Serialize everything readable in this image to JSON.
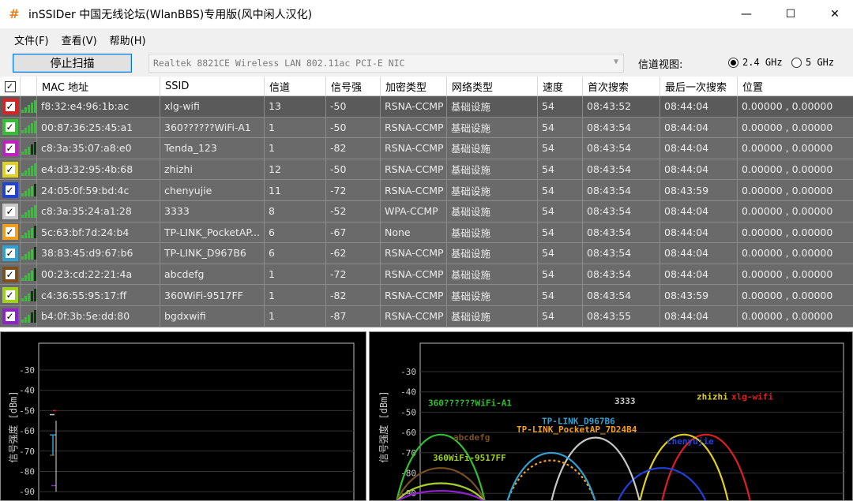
{
  "window": {
    "icon": "#",
    "title": "inSSIDer 中国无线论坛(WlanBBS)专用版(风中闲人汉化)",
    "controls": {
      "minimize": "—",
      "maximize": "☐",
      "close": "✕"
    }
  },
  "menu": [
    "文件(F)",
    "查看(V)",
    "帮助(H)"
  ],
  "toolbar": {
    "scan_button": "停止扫描",
    "nic": "Realtek 8821CE Wireless LAN 802.11ac PCI-E NIC",
    "channel_view_label": "信道视图:",
    "band_24": "2.4 GHz",
    "band_5": "5 GHz",
    "selected_band": "2.4 GHz"
  },
  "table": {
    "headers": [
      "MAC 地址",
      "SSID",
      "信道",
      "信号强",
      "加密类型",
      "网络类型",
      "速度",
      "首次搜索",
      "最后一次搜索",
      "位置"
    ],
    "rows": [
      {
        "color": "#e02020",
        "bars": 5,
        "mac": "f8:32:e4:96:1b:ac",
        "ssid": "xlg-wifi",
        "channel": "13",
        "rssi": "-50",
        "security": "RSNA-CCMP",
        "net_type": "基础设施",
        "speed": "54",
        "first": "08:43:52",
        "last": "08:44:04",
        "loc": "0.00000 , 0.00000"
      },
      {
        "color": "#30c030",
        "bars": 5,
        "mac": "00:87:36:25:45:a1",
        "ssid": "360??????WiFi-A1",
        "channel": "1",
        "rssi": "-50",
        "security": "RSNA-CCMP",
        "net_type": "基础设施",
        "speed": "54",
        "first": "08:43:54",
        "last": "08:44:04",
        "loc": "0.00000 , 0.00000"
      },
      {
        "color": "#c020c0",
        "bars": 3,
        "mac": "c8:3a:35:07:a8:e0",
        "ssid": "Tenda_123",
        "channel": "1",
        "rssi": "-82",
        "security": "RSNA-CCMP",
        "net_type": "基础设施",
        "speed": "54",
        "first": "08:43:54",
        "last": "08:44:04",
        "loc": "0.00000 , 0.00000"
      },
      {
        "color": "#e0d020",
        "bars": 5,
        "mac": "e4:d3:32:95:4b:68",
        "ssid": "zhizhi",
        "channel": "12",
        "rssi": "-50",
        "security": "RSNA-CCMP",
        "net_type": "基础设施",
        "speed": "54",
        "first": "08:43:54",
        "last": "08:44:04",
        "loc": "0.00000 , 0.00000"
      },
      {
        "color": "#2040e0",
        "bars": 4,
        "mac": "24:05:0f:59:bd:4c",
        "ssid": "chenyujie",
        "channel": "11",
        "rssi": "-72",
        "security": "RSNA-CCMP",
        "net_type": "基础设施",
        "speed": "54",
        "first": "08:43:54",
        "last": "08:43:59",
        "loc": "0.00000 , 0.00000"
      },
      {
        "color": "#c8c8c8",
        "bars": 5,
        "mac": "c8:3a:35:24:a1:28",
        "ssid": "3333",
        "channel": "8",
        "rssi": "-52",
        "security": "WPA-CCMP",
        "net_type": "基础设施",
        "speed": "54",
        "first": "08:43:54",
        "last": "08:44:04",
        "loc": "0.00000 , 0.00000"
      },
      {
        "color": "#f0a020",
        "bars": 4,
        "mac": "5c:63:bf:7d:24:b4",
        "ssid": "TP-LINK_PocketAP...",
        "channel": "6",
        "rssi": "-67",
        "security": "None",
        "net_type": "基础设施",
        "speed": "54",
        "first": "08:43:54",
        "last": "08:44:04",
        "loc": "0.00000 , 0.00000"
      },
      {
        "color": "#30a0d0",
        "bars": 4,
        "mac": "38:83:45:d9:67:b6",
        "ssid": "TP-LINK_D967B6",
        "channel": "6",
        "rssi": "-62",
        "security": "RSNA-CCMP",
        "net_type": "基础设施",
        "speed": "54",
        "first": "08:43:54",
        "last": "08:44:04",
        "loc": "0.00000 , 0.00000"
      },
      {
        "color": "#7a5020",
        "bars": 4,
        "mac": "00:23:cd:22:21:4a",
        "ssid": "abcdefg",
        "channel": "1",
        "rssi": "-72",
        "security": "RSNA-CCMP",
        "net_type": "基础设施",
        "speed": "54",
        "first": "08:43:54",
        "last": "08:44:04",
        "loc": "0.00000 , 0.00000"
      },
      {
        "color": "#a0d020",
        "bars": 3,
        "mac": "c4:36:55:95:17:ff",
        "ssid": "360WiFi-9517FF",
        "channel": "1",
        "rssi": "-82",
        "security": "RSNA-CCMP",
        "net_type": "基础设施",
        "speed": "54",
        "first": "08:43:54",
        "last": "08:43:59",
        "loc": "0.00000 , 0.00000"
      },
      {
        "color": "#9020d0",
        "bars": 3,
        "mac": "b4:0f:3b:5e:dd:80",
        "ssid": "bgdxwifi",
        "channel": "1",
        "rssi": "-87",
        "security": "RSNA-CCMP",
        "net_type": "基础设施",
        "speed": "54",
        "first": "08:43:55",
        "last": "08:44:04",
        "loc": "0.00000 , 0.00000"
      }
    ]
  },
  "graphs": {
    "ylabel": "信号强度 [dBm]",
    "yticks": [
      "-30",
      "-40",
      "-50",
      "-60",
      "-70",
      "-80",
      "-90"
    ],
    "labels": {
      "a1": "360??????WiFi-A1",
      "abcdefg": "abcdefg",
      "w9517": "360WiFi-9517FF",
      "d967": "TP-LINK_D967B6",
      "pocket": "TP-LINK_PocketAP_7D24B4",
      "s3333": "3333",
      "chen": "chenyujie",
      "zhizhi": "zhizhi",
      "xlg": "xlg-wifi"
    }
  }
}
